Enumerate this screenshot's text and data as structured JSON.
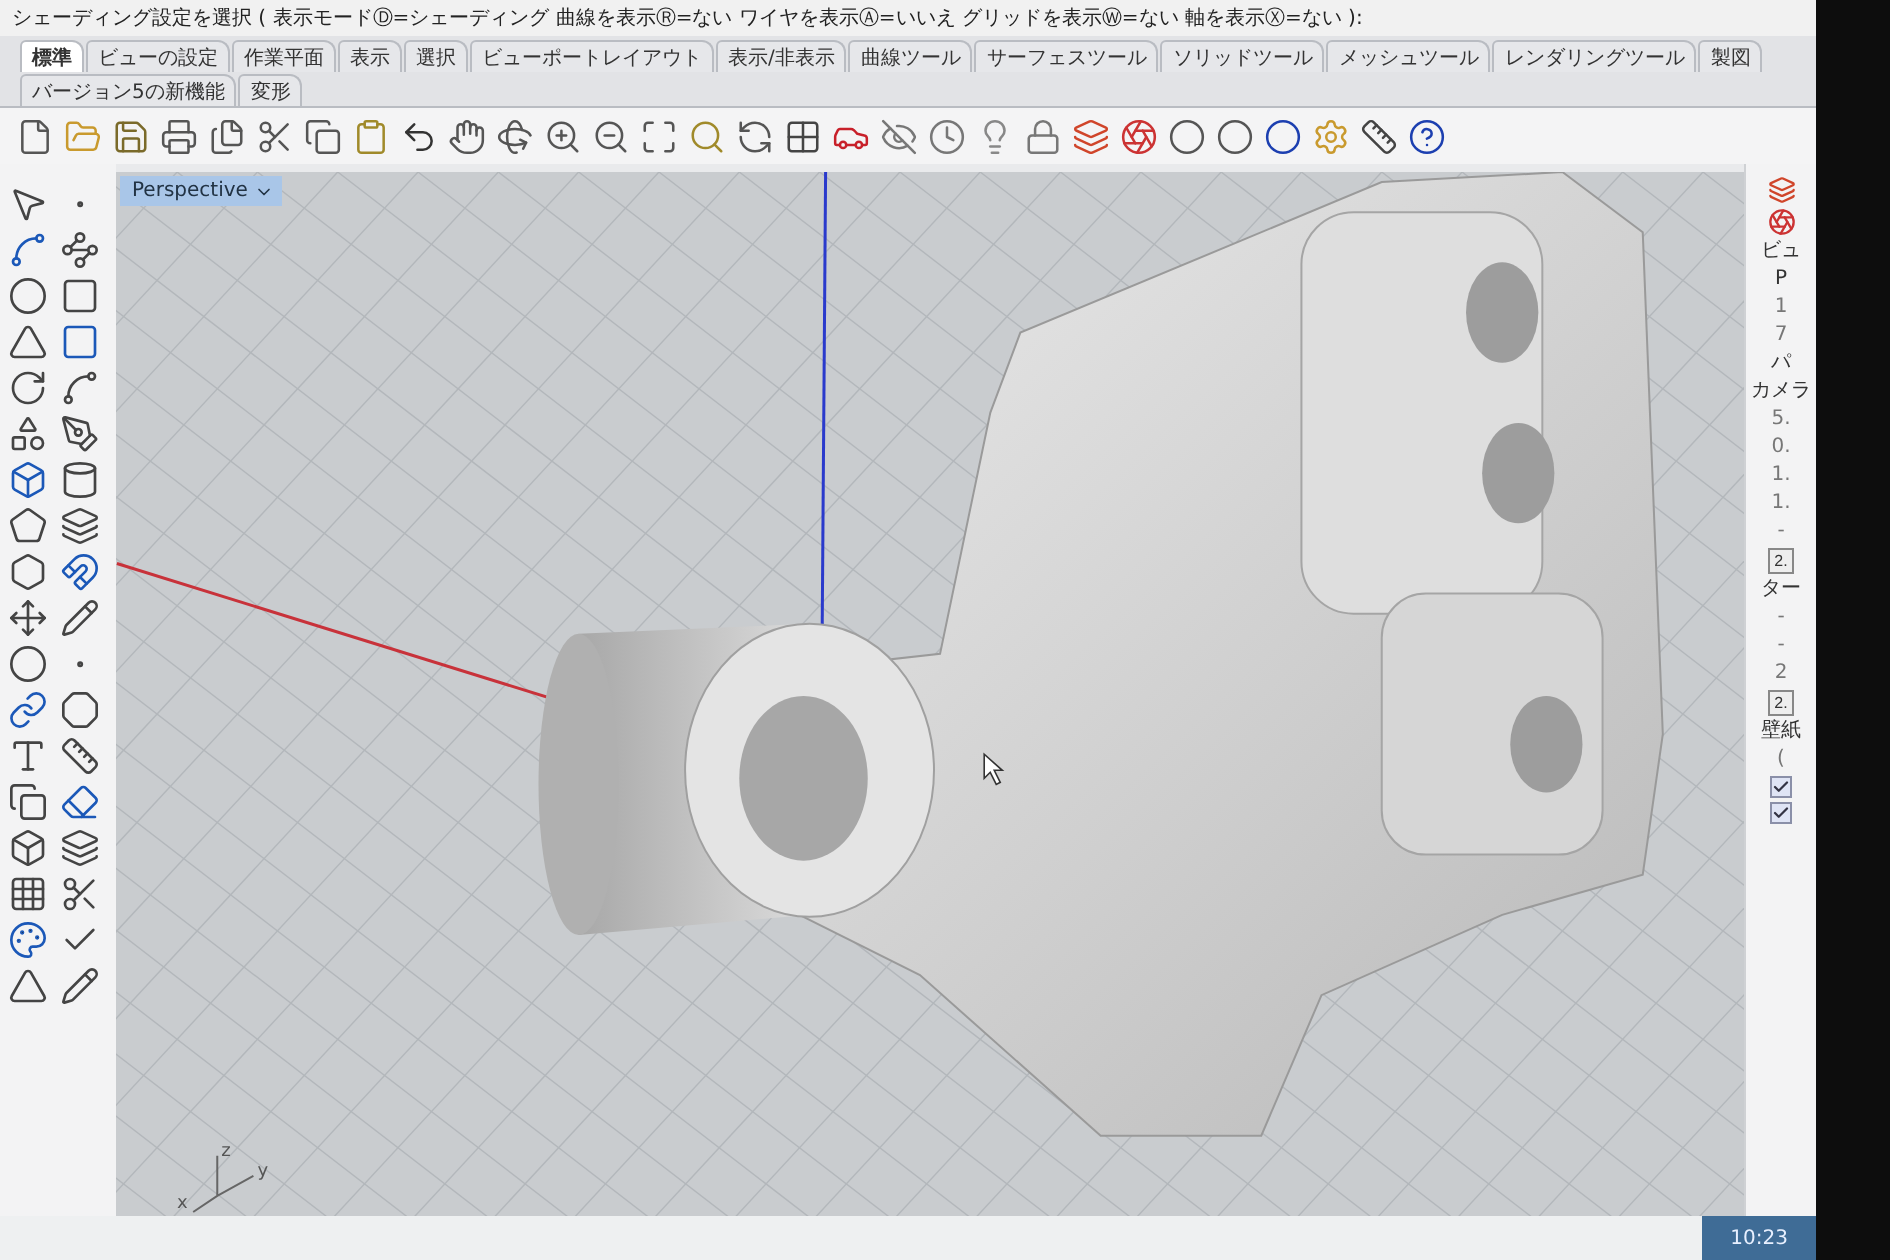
{
  "command_line": "シェーディング設定を選択 ( 表示モードⒹ=シェーディング 曲線を表示Ⓡ=ない ワイヤを表示Ⓐ=いいえ グリッドを表示Ⓦ=ない 軸を表示Ⓧ=ない ):",
  "tabs": [
    {
      "label": "標準",
      "selected": true
    },
    {
      "label": "ビューの設定",
      "selected": false
    },
    {
      "label": "作業平面",
      "selected": false
    },
    {
      "label": "表示",
      "selected": false
    },
    {
      "label": "選択",
      "selected": false
    },
    {
      "label": "ビューポートレイアウト",
      "selected": false
    },
    {
      "label": "表示/非表示",
      "selected": false
    },
    {
      "label": "曲線ツール",
      "selected": false
    },
    {
      "label": "サーフェスツール",
      "selected": false
    },
    {
      "label": "ソリッドツール",
      "selected": false
    },
    {
      "label": "メッシュツール",
      "selected": false
    },
    {
      "label": "レンダリングツール",
      "selected": false
    },
    {
      "label": "製図",
      "selected": false
    },
    {
      "label": "バージョン5の新機能",
      "selected": false
    },
    {
      "label": "変形",
      "selected": false
    }
  ],
  "viewport": {
    "title": "Perspective",
    "axis_labels": [
      "z",
      "y",
      "x"
    ]
  },
  "properties_panel": [
    {
      "kind": "label",
      "text": "ビュ"
    },
    {
      "kind": "label",
      "text": "P"
    },
    {
      "kind": "value",
      "text": "1"
    },
    {
      "kind": "value",
      "text": "7"
    },
    {
      "kind": "label",
      "text": "パ"
    },
    {
      "kind": "label",
      "text": "カメラ"
    },
    {
      "kind": "value",
      "text": "5."
    },
    {
      "kind": "value",
      "text": "0."
    },
    {
      "kind": "value",
      "text": "1."
    },
    {
      "kind": "value",
      "text": "1."
    },
    {
      "kind": "value",
      "text": "-"
    },
    {
      "kind": "button",
      "text": "2."
    },
    {
      "kind": "label",
      "text": "ター"
    },
    {
      "kind": "value",
      "text": "-"
    },
    {
      "kind": "value",
      "text": "-"
    },
    {
      "kind": "value",
      "text": "2"
    },
    {
      "kind": "button",
      "text": "2."
    },
    {
      "kind": "label",
      "text": "壁紙"
    },
    {
      "kind": "value",
      "text": "("
    },
    {
      "kind": "checkbox",
      "checked": true
    },
    {
      "kind": "checkbox",
      "checked": true
    }
  ],
  "taskbar": {
    "time": "10:23"
  }
}
